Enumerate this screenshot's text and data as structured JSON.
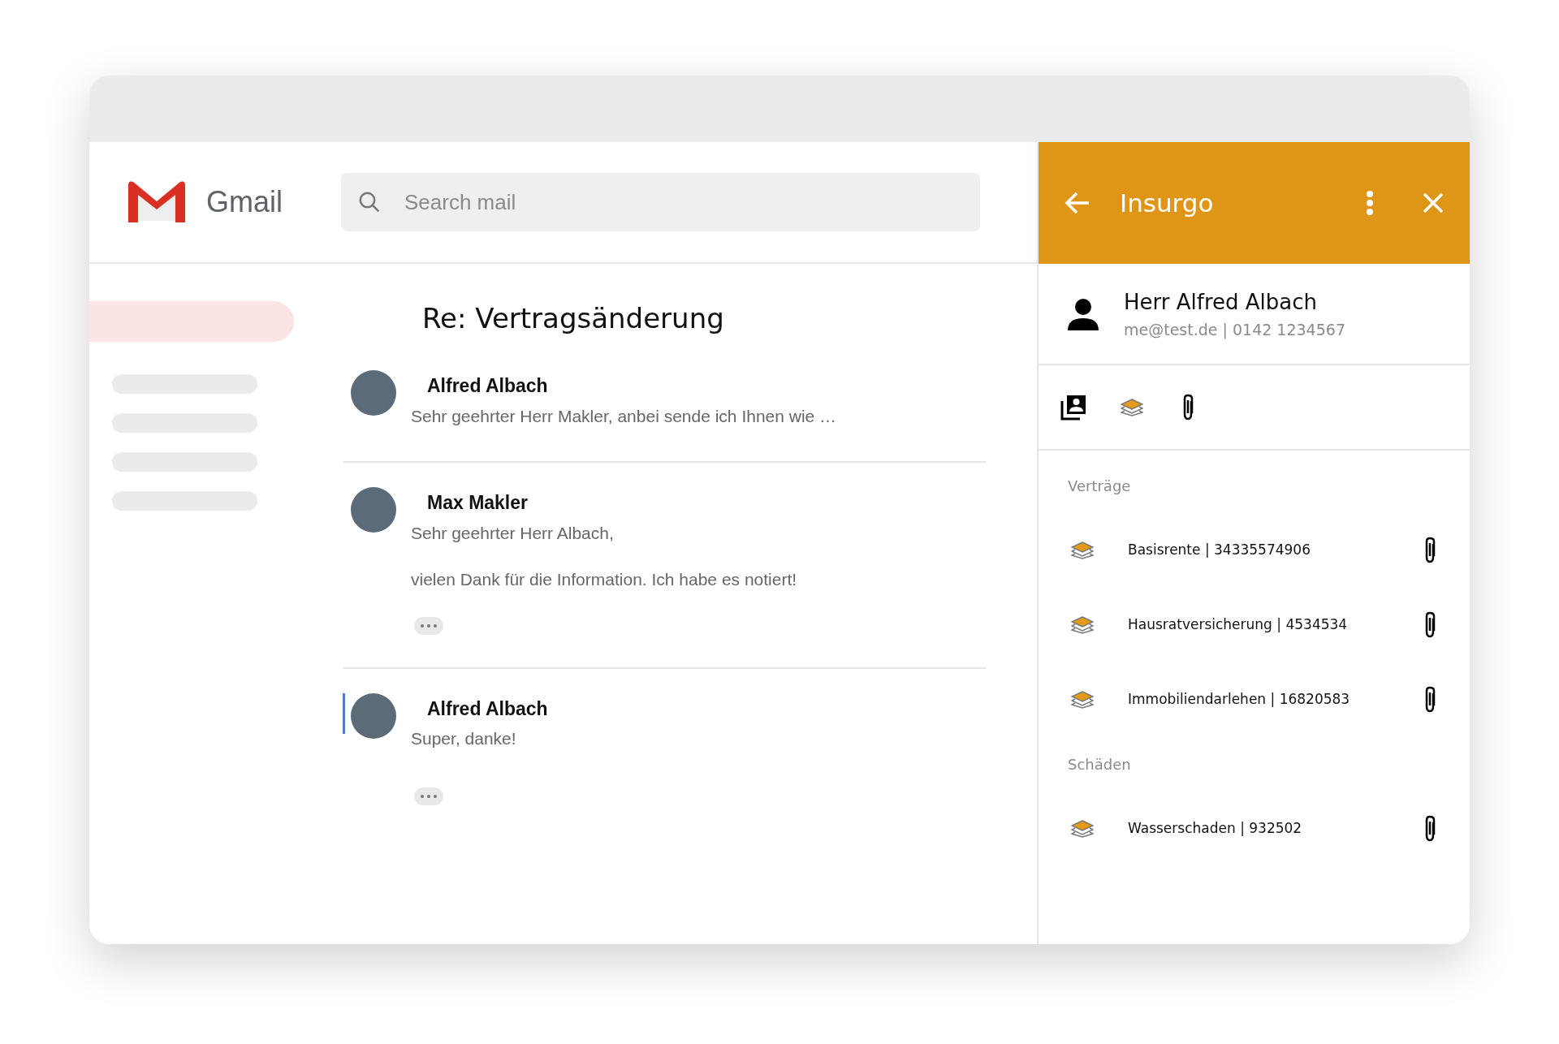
{
  "mail": {
    "logo_text": "Gmail",
    "search": {
      "placeholder": "Search mail"
    }
  },
  "thread": {
    "subject": "Re: Vertragsänderung",
    "messages": [
      {
        "sender": "Alfred Albach",
        "lines": [
          "Sehr geehrter Herr Makler, anbei sende ich Ihnen wie …"
        ],
        "has_more": false,
        "selected": false
      },
      {
        "sender": "Max Makler",
        "lines": [
          "Sehr geehrter Herr Albach,",
          "vielen Dank für die Information. Ich habe es notiert!"
        ],
        "has_more": true,
        "selected": false
      },
      {
        "sender": "Alfred Albach",
        "lines": [
          "Super, danke!"
        ],
        "has_more": true,
        "selected": true
      }
    ]
  },
  "panel": {
    "title": "Insurgo",
    "contact": {
      "name": "Herr Alfred Albach",
      "details": "me@test.de | 0142 1234567"
    },
    "sections": [
      {
        "title": "Verträge",
        "items": [
          {
            "label": "Basisrente | 34335574906"
          },
          {
            "label": "Hausratversicherung | 4534534"
          },
          {
            "label": "Immobiliendarlehen | 16820583"
          }
        ]
      },
      {
        "title": "Schäden",
        "items": [
          {
            "label": "Wasserschaden | 932502"
          }
        ]
      }
    ]
  }
}
